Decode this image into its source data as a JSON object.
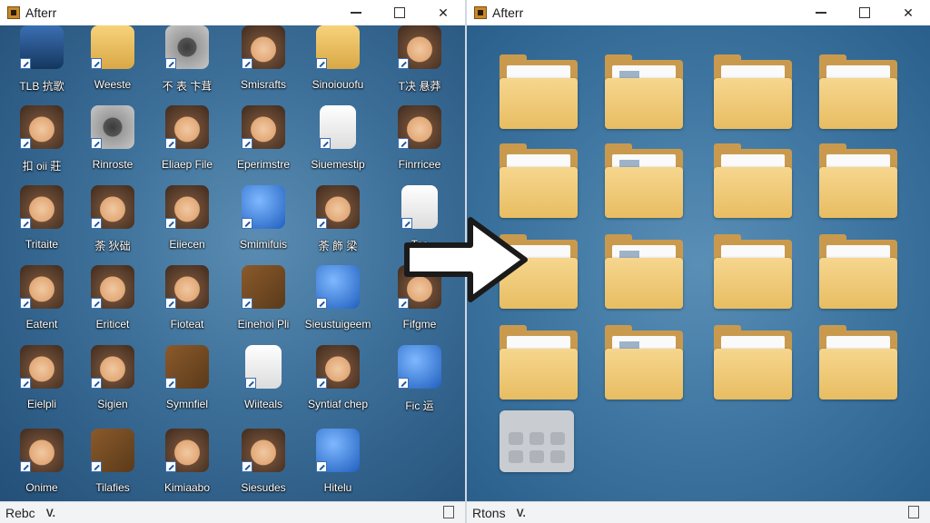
{
  "left_window": {
    "title": "Afterr",
    "status_text": "Rebc",
    "status_icon": "V.",
    "icons": [
      {
        "label": "TLB 抗歌",
        "kind": "monitor"
      },
      {
        "label": "Weeste",
        "kind": "folder"
      },
      {
        "label": "不 表 卞茸",
        "kind": "cam"
      },
      {
        "label": "Smisrafts",
        "kind": "face"
      },
      {
        "label": "Sinoiouofu",
        "kind": "folder"
      },
      {
        "label": "T决 悬莽",
        "kind": "face"
      },
      {
        "label": "扣 oii 莊",
        "kind": "face"
      },
      {
        "label": "Rinroste",
        "kind": "cam"
      },
      {
        "label": "Eliaep File",
        "kind": "face"
      },
      {
        "label": "Eperimstre",
        "kind": "face"
      },
      {
        "label": "Siuemestip",
        "kind": "doc"
      },
      {
        "label": "Finrricee",
        "kind": "face"
      },
      {
        "label": "Tritaite",
        "kind": "face"
      },
      {
        "label": "荼 狄础",
        "kind": "face"
      },
      {
        "label": "Eiiecen",
        "kind": "face"
      },
      {
        "label": "Smimifuis",
        "kind": "blue"
      },
      {
        "label": "荼 飾 梁",
        "kind": "face"
      },
      {
        "label": "Tec",
        "kind": "doc"
      },
      {
        "label": "Eatent",
        "kind": "face"
      },
      {
        "label": "Eriticet",
        "kind": "face"
      },
      {
        "label": "Fioteat",
        "kind": "face"
      },
      {
        "label": "Einehoi Pli",
        "kind": "tool"
      },
      {
        "label": "Sieustuigeem",
        "kind": "blue"
      },
      {
        "label": "Fifgme",
        "kind": "face"
      },
      {
        "label": "Eielpli",
        "kind": "face"
      },
      {
        "label": "Sigien",
        "kind": "face"
      },
      {
        "label": "Symnfiel",
        "kind": "tool"
      },
      {
        "label": "Wiiteals",
        "kind": "doc"
      },
      {
        "label": "Syntiaf chep",
        "kind": "face"
      },
      {
        "label": "Fic 运",
        "kind": "blue"
      },
      {
        "label": "Onime",
        "kind": "face"
      },
      {
        "label": "Tilafies",
        "kind": "tool"
      },
      {
        "label": "Kimiaabo",
        "kind": "face"
      },
      {
        "label": "Siesudes",
        "kind": "face"
      },
      {
        "label": "Hitelu",
        "kind": "blue"
      }
    ]
  },
  "right_window": {
    "title": "Afterr",
    "status_text": "Rtons",
    "status_icon": "V.",
    "folder_count": 16
  },
  "window_controls": {
    "minimize": "—",
    "maximize": "□",
    "close": "✕"
  },
  "colors": {
    "folder_front": "#f2cf82",
    "folder_back": "#c99a4e",
    "desktop_blue": "#3c6f98"
  }
}
